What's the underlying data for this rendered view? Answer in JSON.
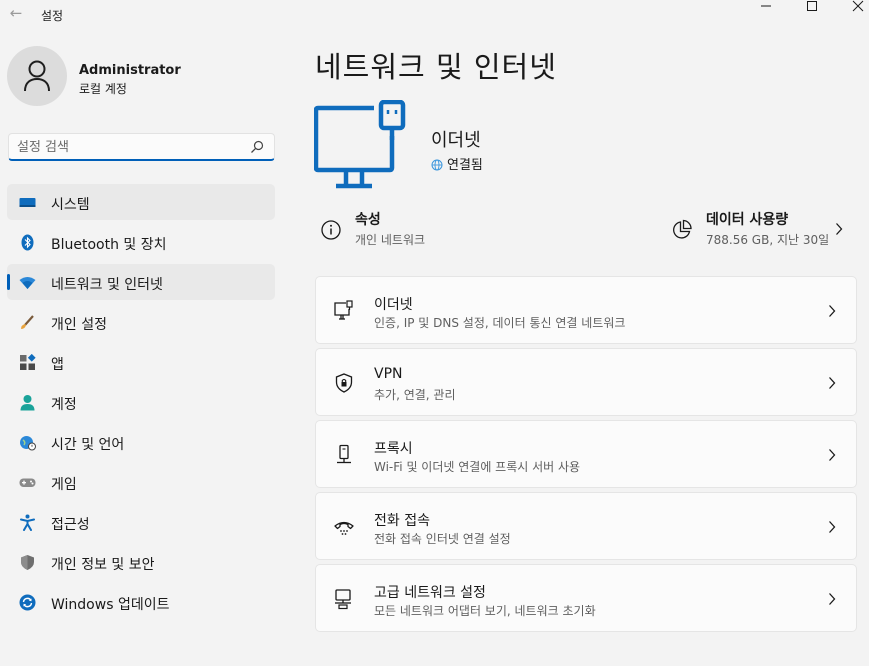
{
  "window": {
    "title": "설정"
  },
  "profile": {
    "name": "Administrator",
    "account_type": "로컬 계정"
  },
  "search": {
    "placeholder": "설정 검색"
  },
  "sidebar": {
    "items": [
      {
        "label": "시스템",
        "icon": "system-icon"
      },
      {
        "label": "Bluetooth 및 장치",
        "icon": "bluetooth-icon"
      },
      {
        "label": "네트워크 및 인터넷",
        "icon": "network-icon",
        "selected": true
      },
      {
        "label": "개인 설정",
        "icon": "personalization-icon"
      },
      {
        "label": "앱",
        "icon": "apps-icon"
      },
      {
        "label": "계정",
        "icon": "accounts-icon"
      },
      {
        "label": "시간 및 언어",
        "icon": "time-language-icon"
      },
      {
        "label": "게임",
        "icon": "gaming-icon"
      },
      {
        "label": "접근성",
        "icon": "accessibility-icon"
      },
      {
        "label": "개인 정보 및 보안",
        "icon": "privacy-security-icon"
      },
      {
        "label": "Windows 업데이트",
        "icon": "windows-update-icon"
      }
    ]
  },
  "main": {
    "title": "네트워크 및 인터넷",
    "connection": {
      "name": "이더넷",
      "status": "연결됨"
    },
    "properties": {
      "title": "속성",
      "subtitle": "개인 네트워크"
    },
    "data_usage": {
      "title": "데이터 사용량",
      "subtitle": "788.56 GB, 지난 30일"
    },
    "cards": [
      {
        "title": "이더넷",
        "subtitle": "인증, IP 및 DNS 설정, 데이터 통신 연결 네트워크",
        "icon": "ethernet-icon"
      },
      {
        "title": "VPN",
        "subtitle": "추가, 연결, 관리",
        "icon": "vpn-shield-icon"
      },
      {
        "title": "프록시",
        "subtitle": "Wi-Fi 및 이더넷 연결에 프록시 서버 사용",
        "icon": "proxy-icon"
      },
      {
        "title": "전화 접속",
        "subtitle": "전화 접속 인터넷 연결 설정",
        "icon": "dial-up-icon"
      },
      {
        "title": "고급 네트워크 설정",
        "subtitle": "모든 네트워크 어댑터 보기, 네트워크 초기화",
        "icon": "advanced-network-icon"
      }
    ]
  },
  "colors": {
    "accent": "#005fb8",
    "background": "#f3f3f3",
    "card": "#fbfbfb"
  }
}
